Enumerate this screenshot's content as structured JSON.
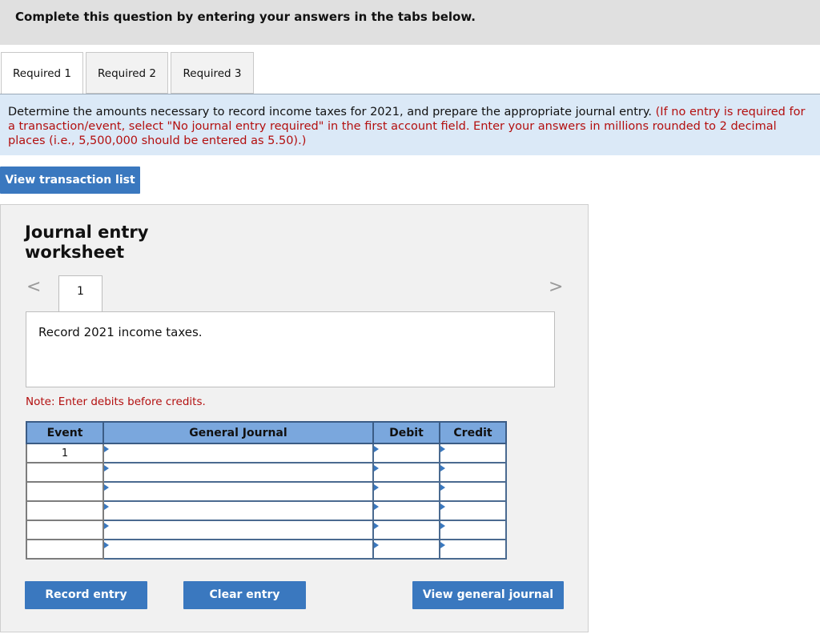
{
  "header": {
    "title": "Complete this question by entering your answers in the tabs below."
  },
  "tabs": [
    {
      "label": "Required 1",
      "active": true
    },
    {
      "label": "Required 2",
      "active": false
    },
    {
      "label": "Required 3",
      "active": false
    }
  ],
  "instructions": {
    "main": "Determine the amounts necessary to record income taxes for 2021, and prepare the appropriate journal entry.",
    "note": "(If no entry is required for a transaction/event, select \"No journal entry required\" in the first account field. Enter your answers in millions rounded to 2 decimal places (i.e., 5,500,000 should be entered as 5.50).)"
  },
  "view_transaction_list": "View transaction list",
  "worksheet": {
    "title": "Journal entry worksheet",
    "nav_prev": "<",
    "nav_next": ">",
    "entry_number": "1",
    "description": "Record 2021 income taxes.",
    "note": "Note: Enter debits before credits.",
    "columns": {
      "event": "Event",
      "general_journal": "General Journal",
      "debit": "Debit",
      "credit": "Credit"
    },
    "rows": [
      {
        "event": "1",
        "account": "",
        "debit": "",
        "credit": ""
      },
      {
        "event": "",
        "account": "",
        "debit": "",
        "credit": ""
      },
      {
        "event": "",
        "account": "",
        "debit": "",
        "credit": ""
      },
      {
        "event": "",
        "account": "",
        "debit": "",
        "credit": ""
      },
      {
        "event": "",
        "account": "",
        "debit": "",
        "credit": ""
      },
      {
        "event": "",
        "account": "",
        "debit": "",
        "credit": ""
      }
    ],
    "record_entry": "Record entry",
    "clear_entry": "Clear entry",
    "view_general_journal": "View general journal"
  },
  "colors": {
    "accent": "#3a78bf",
    "note_red": "#b30f0f",
    "instruction_bg": "#dbe9f7",
    "table_header": "#7aa7dd"
  }
}
